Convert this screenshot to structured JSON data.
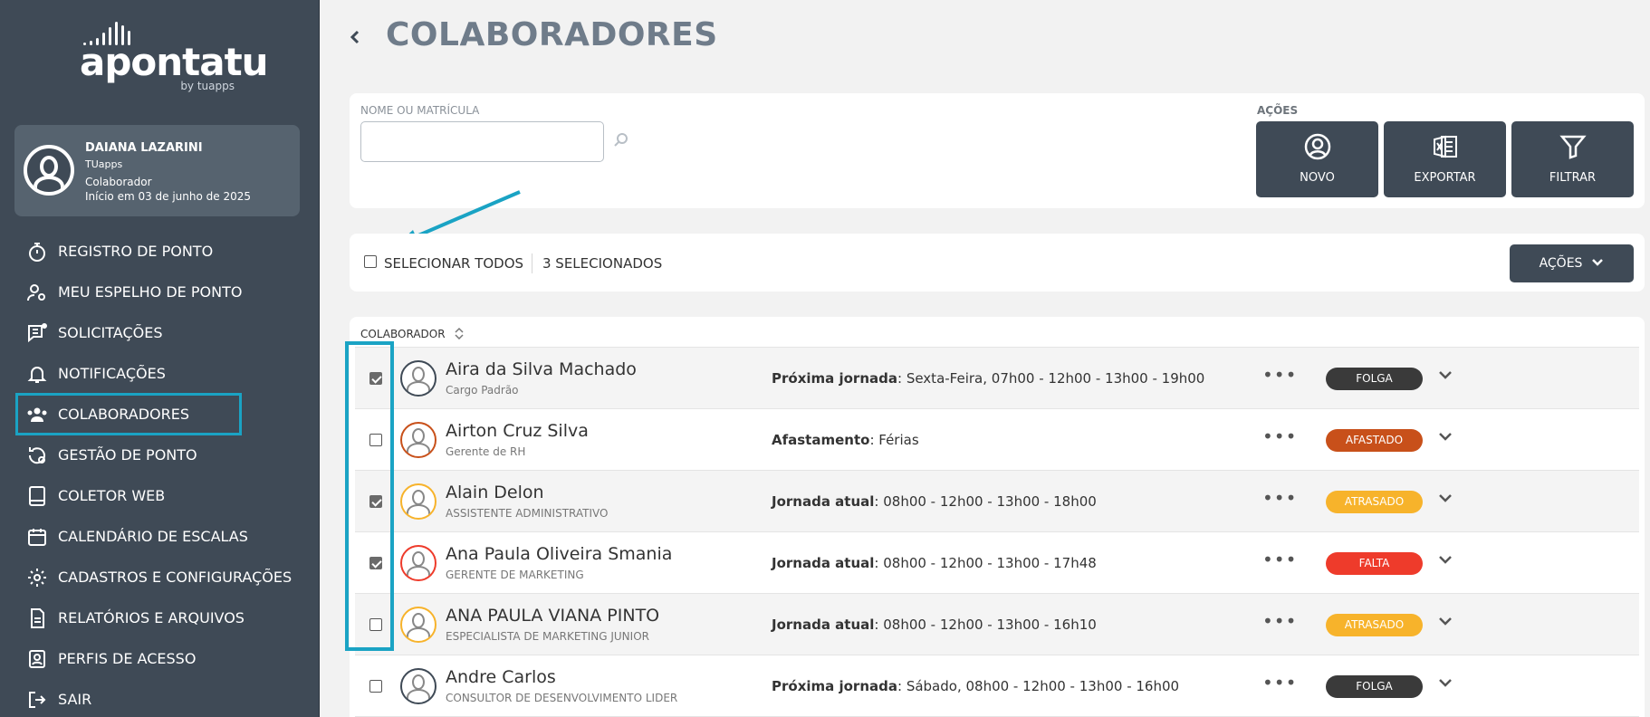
{
  "brand": {
    "wordmark": "apontatu",
    "byline": "by tuapps"
  },
  "profile": {
    "name": "DAIANA LAZARINI",
    "company": "TUapps",
    "role": "Colaborador",
    "start": "Início em 03 de junho de 2025"
  },
  "nav": [
    {
      "label": "REGISTRO DE PONTO",
      "icon": "stopwatch-icon"
    },
    {
      "label": "MEU ESPELHO DE PONTO",
      "icon": "user-settings-icon"
    },
    {
      "label": "SOLICITAÇÕES",
      "icon": "message-notification-icon"
    },
    {
      "label": "NOTIFICAÇÕES",
      "icon": "bell-icon"
    },
    {
      "label": "COLABORADORES",
      "icon": "users-icon"
    },
    {
      "label": "GESTÃO DE PONTO",
      "icon": "history-settings-icon"
    },
    {
      "label": "COLETOR WEB",
      "icon": "tablet-icon"
    },
    {
      "label": "CALENDÁRIO DE ESCALAS",
      "icon": "calendar-icon"
    },
    {
      "label": "CADASTROS E CONFIGURAÇÕES",
      "icon": "gear-icon"
    },
    {
      "label": "RELATÓRIOS E ARQUIVOS",
      "icon": "document-icon"
    },
    {
      "label": "PERFIS DE ACESSO",
      "icon": "id-badge-icon"
    },
    {
      "label": "SAIR",
      "icon": "logout-icon"
    }
  ],
  "page": {
    "title": "COLABORADORES"
  },
  "search": {
    "label": "NOME OU MATRÍCULA",
    "value": "",
    "placeholder": ""
  },
  "actions": {
    "label": "AÇÕES",
    "buttons": [
      {
        "label": "NOVO",
        "icon": "user-circle-icon"
      },
      {
        "label": "EXPORTAR",
        "icon": "excel-icon"
      },
      {
        "label": "FILTRAR",
        "icon": "filter-icon"
      }
    ]
  },
  "selection": {
    "select_all_label": "SELECIONAR TODOS",
    "count_label": "3 SELECIONADOS",
    "actions_dropdown": "AÇÕES"
  },
  "table": {
    "column_header": "COLABORADOR",
    "rows": [
      {
        "name": "Aira da Silva Machado",
        "role": "Cargo Padrão",
        "info_label": "Próxima jornada",
        "info_value": ": Sexta-Feira, 07h00 - 12h00  -  13h00 - 19h00",
        "status": "FOLGA",
        "status_color": "#3a3a3a",
        "avatar_color": "#3f4a56",
        "checked": true
      },
      {
        "name": "Airton Cruz Silva",
        "role": "Gerente de RH",
        "info_label": "Afastamento",
        "info_value": ": Férias",
        "status": "AFASTADO",
        "status_color": "#c8501a",
        "avatar_color": "#c8501a",
        "checked": false
      },
      {
        "name": "Alain Delon",
        "role": "ASSISTENTE ADMINISTRATIVO",
        "info_label": "Jornada atual",
        "info_value": ": 08h00 - 12h00  -  13h00 - 18h00",
        "status": "ATRASADO",
        "status_color": "#f7b32b",
        "avatar_color": "#f7b32b",
        "checked": true
      },
      {
        "name": "Ana Paula Oliveira Smania",
        "role": "GERENTE DE MARKETING",
        "info_label": "Jornada atual",
        "info_value": ": 08h00 - 12h00  -  13h00 - 17h48",
        "status": "FALTA",
        "status_color": "#ee3b2b",
        "avatar_color": "#ee3b2b",
        "checked": true
      },
      {
        "name": "ANA PAULA VIANA PINTO",
        "role": "ESPECIALISTA DE MARKETING JUNIOR",
        "info_label": "Jornada atual",
        "info_value": ": 08h00 - 12h00  -  13h00 - 16h10",
        "status": "ATRASADO",
        "status_color": "#f7b32b",
        "avatar_color": "#f7b32b",
        "checked": false
      },
      {
        "name": "Andre Carlos",
        "role": "CONSULTOR DE DESENVOLVIMENTO LIDER",
        "info_label": "Próxima jornada",
        "info_value": ": Sábado, 08h00 - 12h00  -  13h00 - 16h00",
        "status": "FOLGA",
        "status_color": "#3a3a3a",
        "avatar_color": "#3f4a56",
        "checked": false
      }
    ]
  },
  "colors": {
    "sidebar": "#3f4a56",
    "accent_highlight": "#1aa3c4",
    "button": "#3f4a56"
  }
}
